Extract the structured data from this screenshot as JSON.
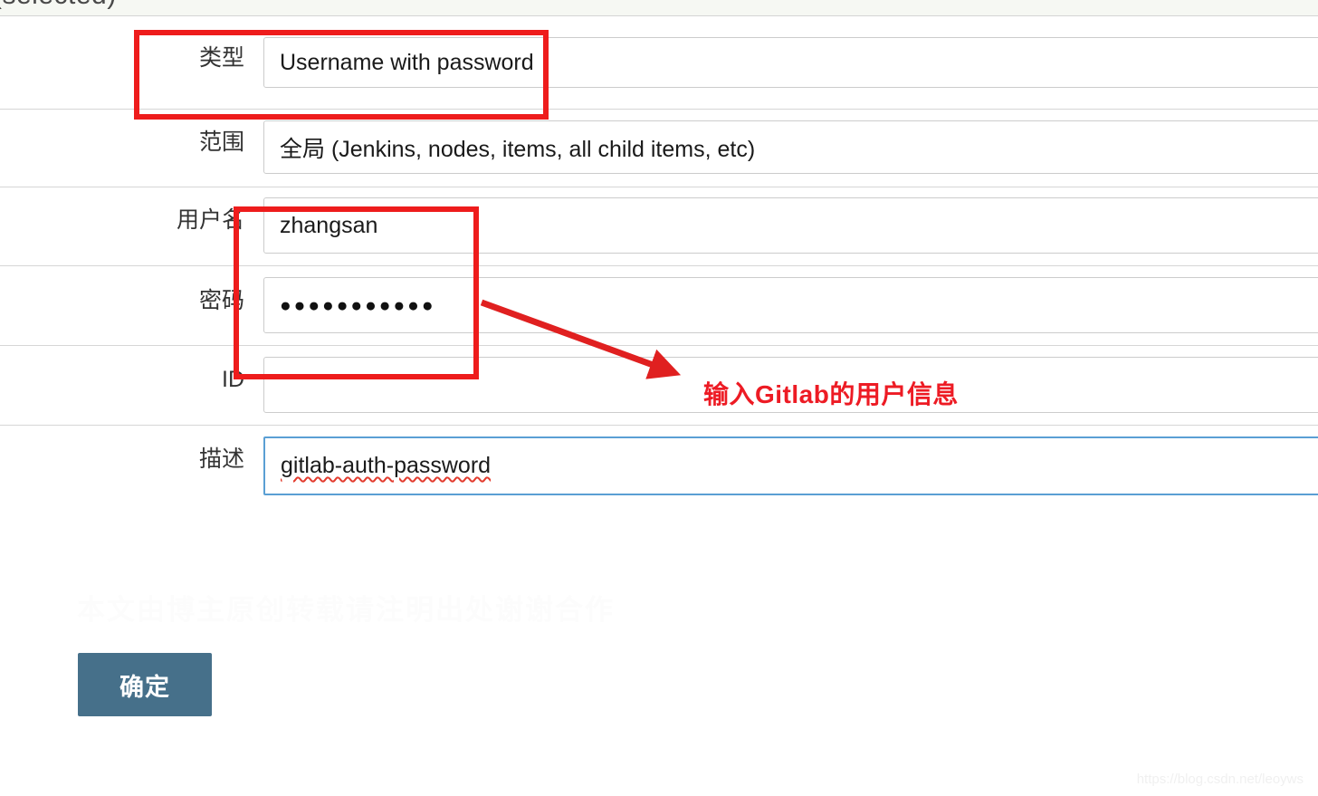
{
  "page": {
    "top_strip_text": "(selected)",
    "top_strip_caret": "▾"
  },
  "form": {
    "rows": [
      {
        "label": "类型",
        "value": "Username with password"
      },
      {
        "label": "范围",
        "value": "全局 (Jenkins, nodes, items, all child items, etc)"
      },
      {
        "label": "用户名",
        "value": "zhangsan"
      },
      {
        "label": "密码",
        "value": "●●●●●●●●●●●"
      },
      {
        "label": "ID",
        "value": ""
      },
      {
        "label": "描述",
        "value": "gitlab-auth-password"
      }
    ]
  },
  "annotations": {
    "callout_text": "输入Gitlab的用户信息",
    "highlight_color": "#ee1c1c",
    "arrow_color": "#e02020"
  },
  "actions": {
    "submit_label": "确定"
  },
  "watermarks": {
    "faint_band": "本文由博主原创转载请注明出处谢谢合作",
    "bottom_right": "https://blog.csdn.net/leoyws"
  },
  "colors": {
    "button_bg": "#46708a",
    "focus_border": "#5a9fd4",
    "field_border": "#cccccc",
    "header_bg": "#f6f8f3"
  }
}
